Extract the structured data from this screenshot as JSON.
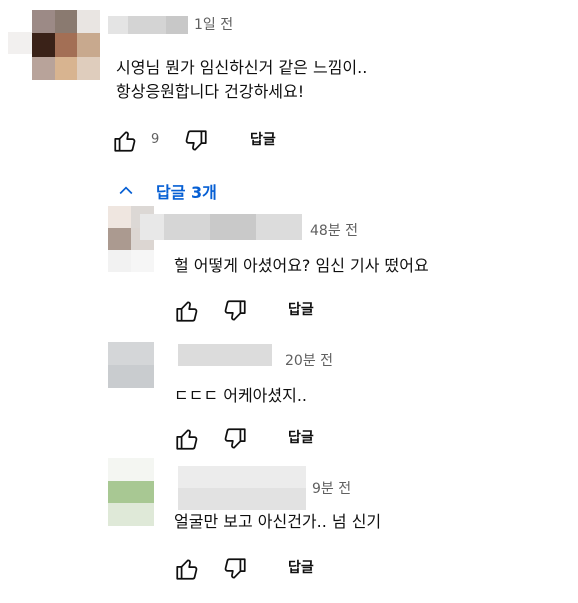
{
  "main_comment": {
    "time": "1일 전",
    "text": "시영님 뭔가 임신하신거 같은 느낌이..\n항상응원합니다 건강하세요!",
    "like_count": "9",
    "reply_label": "답글"
  },
  "replies_toggle": {
    "label": "답글 3개",
    "icon": "chevron-up-icon",
    "color": "#065fd4"
  },
  "replies": [
    {
      "time": "48분 전",
      "text": "헐 어떻게 아셨어요? 임신 기사 떴어요",
      "reply_label": "답글"
    },
    {
      "time": "20분 전",
      "text": "ㄷㄷㄷ 어케아셨지..",
      "reply_label": "답글"
    },
    {
      "time": "9분 전",
      "text": "얼굴만 보고 아신건가.. 넘 신기",
      "reply_label": "답글"
    }
  ],
  "icons": {
    "like": "thumbs-up-icon",
    "dislike": "thumbs-down-icon"
  }
}
